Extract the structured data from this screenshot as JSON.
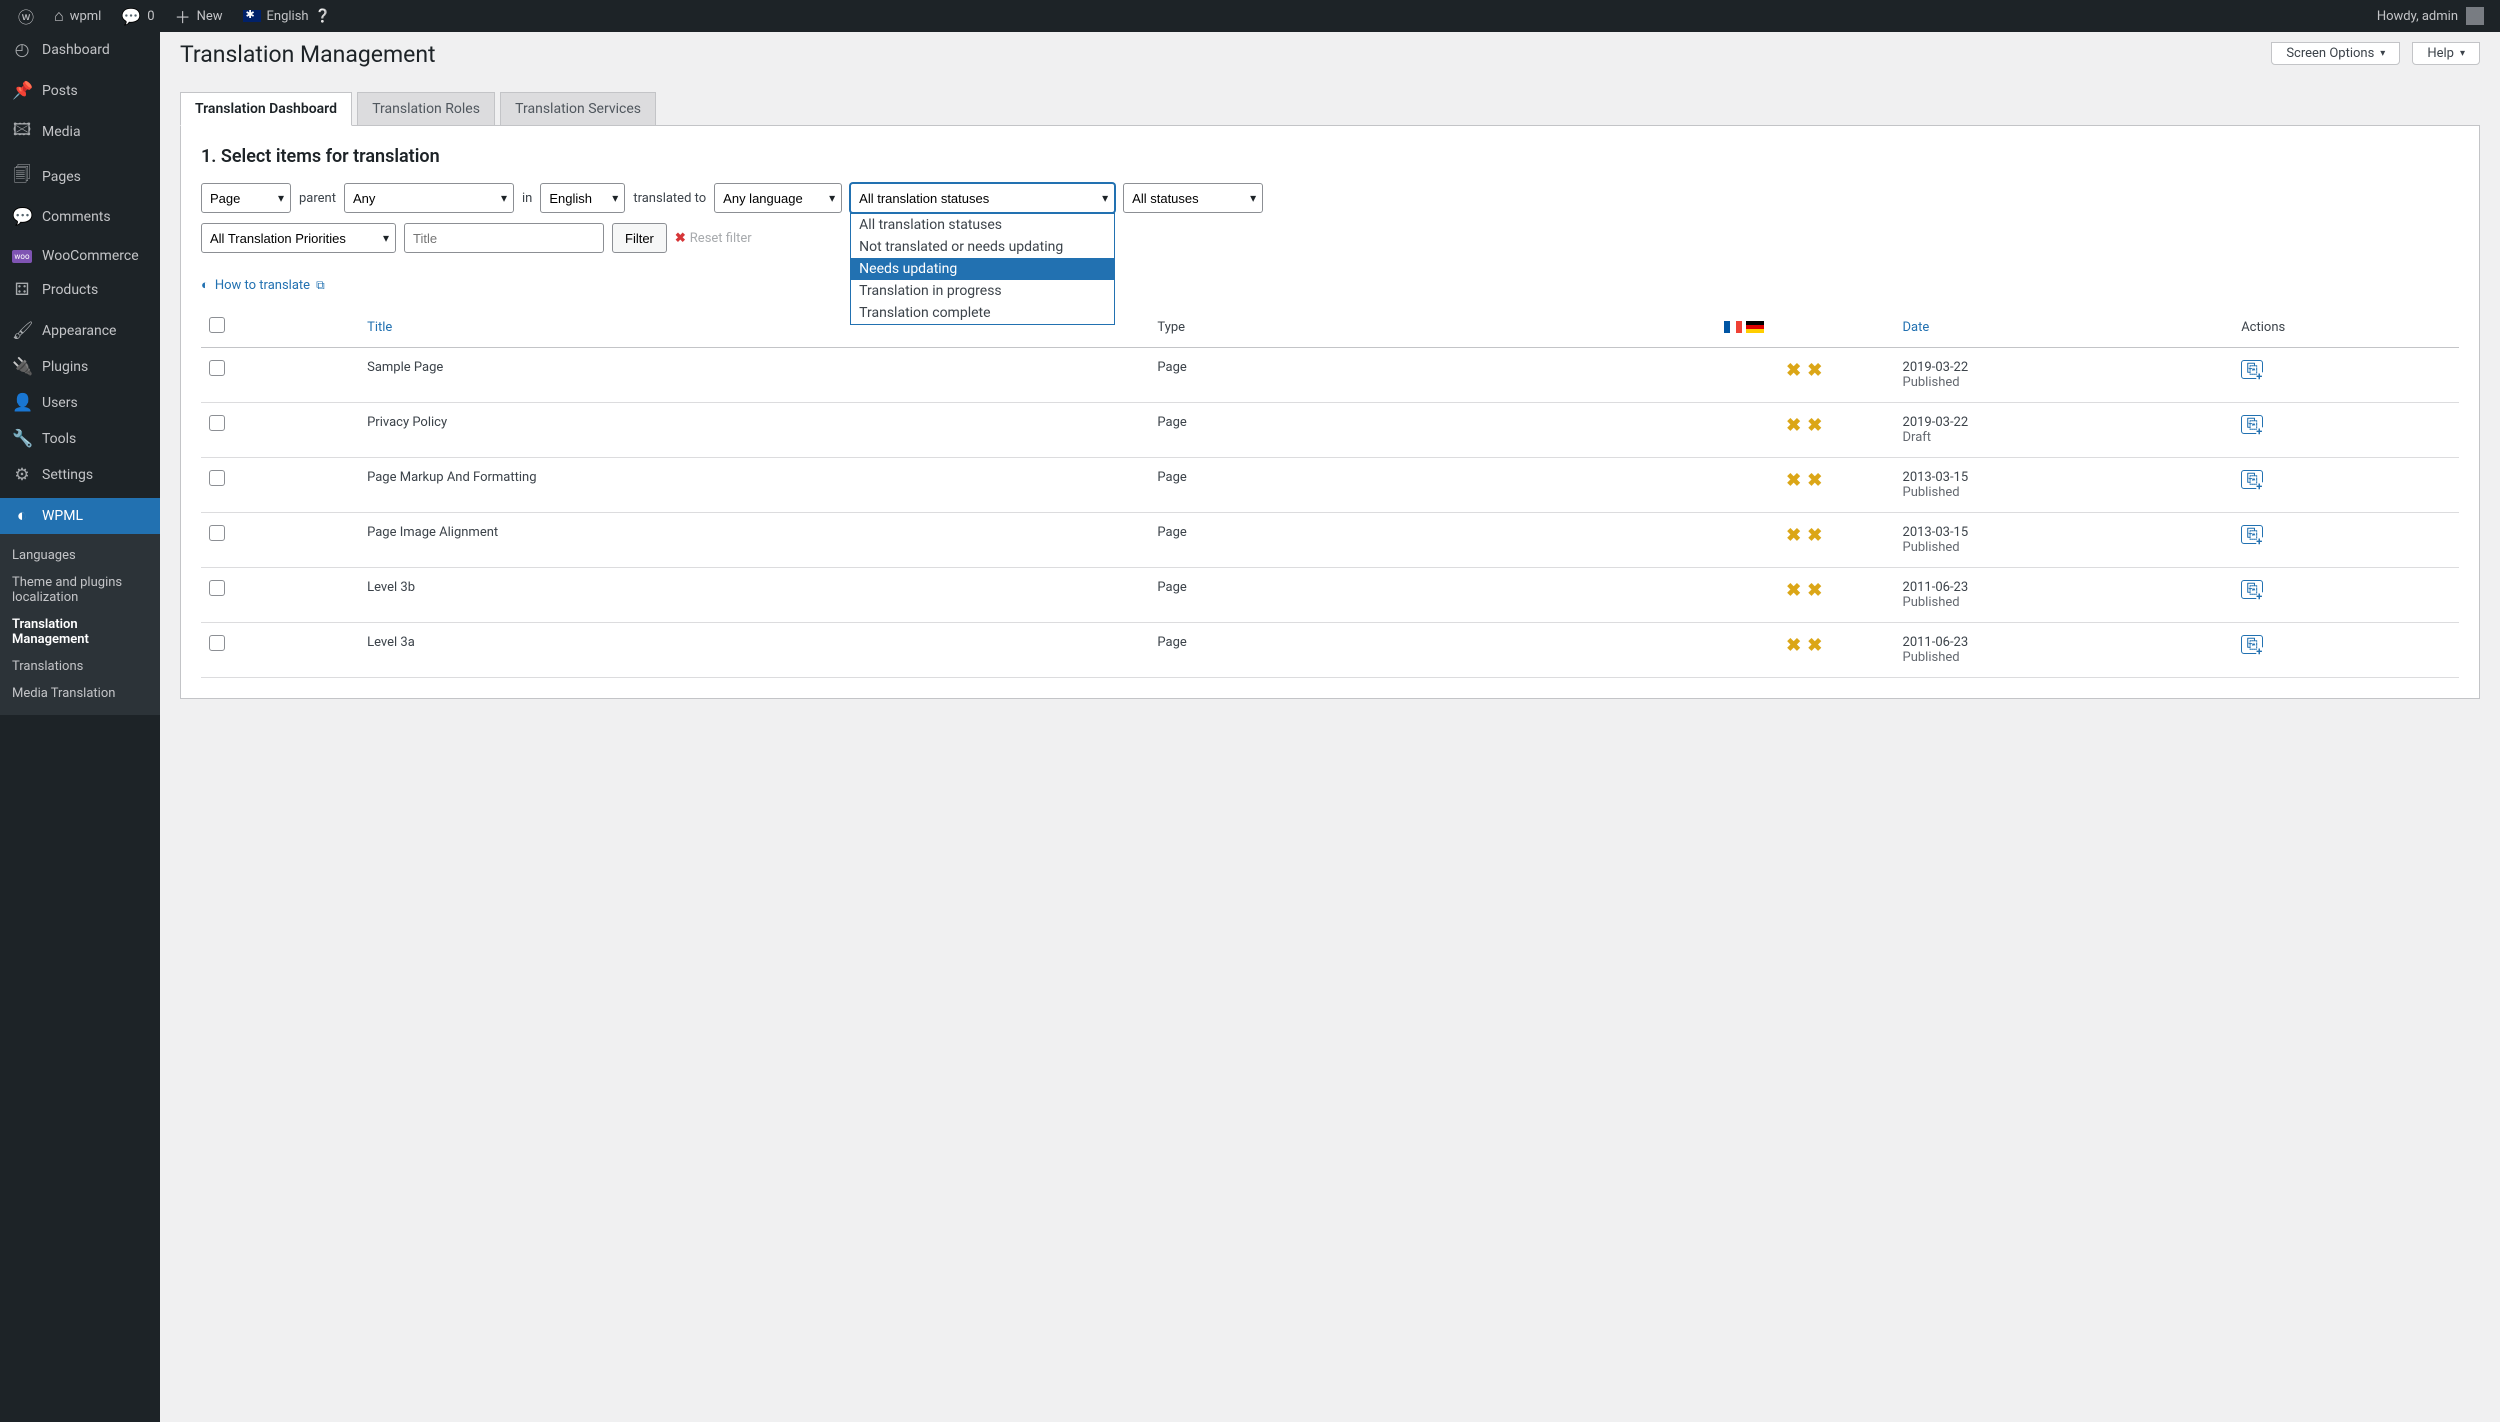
{
  "adminbar": {
    "site_name": "wpml",
    "comments_count": "0",
    "new_label": "New",
    "language": "English",
    "howdy": "Howdy, admin"
  },
  "sidebar": {
    "items": [
      {
        "icon": "⌂",
        "label": "Dashboard"
      },
      {
        "icon": "✎",
        "label": "Posts"
      },
      {
        "icon": "🖾",
        "label": "Media"
      },
      {
        "icon": "🗐",
        "label": "Pages"
      },
      {
        "icon": "💬",
        "label": "Comments"
      }
    ],
    "items2": [
      {
        "icon": "ⓦ",
        "label": "WooCommerce"
      },
      {
        "icon": "⚃",
        "label": "Products"
      }
    ],
    "items3": [
      {
        "icon": "✦",
        "label": "Appearance"
      },
      {
        "icon": "🔌",
        "label": "Plugins"
      },
      {
        "icon": "👤",
        "label": "Users"
      },
      {
        "icon": "🔧",
        "label": "Tools"
      },
      {
        "icon": "⚙",
        "label": "Settings"
      }
    ],
    "active": {
      "icon": "◐",
      "label": "WPML"
    },
    "submenu": [
      "Languages",
      "Theme and plugins localization",
      "Translation Management",
      "Translations",
      "Media Translation"
    ]
  },
  "top_buttons": {
    "screen_options": "Screen Options",
    "help": "Help"
  },
  "page_title": "Translation Management",
  "tabs": [
    "Translation Dashboard",
    "Translation Roles",
    "Translation Services"
  ],
  "section_title": "1. Select items for translation",
  "filters": {
    "type_select": "Page",
    "parent_label": "parent",
    "parent_select": "Any",
    "in_label": "in",
    "lang_select": "English",
    "translated_to_label": "translated to",
    "to_lang_select": "Any language",
    "status_select": "All translation statuses",
    "status_options": [
      "All translation statuses",
      "Not translated or needs updating",
      "Needs updating",
      "Translation in progress",
      "Translation complete"
    ],
    "pub_status_select": "All statuses",
    "priority_select": "All Translation Priorities",
    "title_placeholder": "Title",
    "filter_btn": "Filter",
    "reset_label": "Reset filter"
  },
  "how_to_translate": "How to translate",
  "table": {
    "headers": {
      "title": "Title",
      "type": "Type",
      "date": "Date",
      "actions": "Actions"
    },
    "rows": [
      {
        "title": "Sample Page",
        "type": "Page",
        "date": "2019-03-22",
        "status": "Published"
      },
      {
        "title": "Privacy Policy",
        "type": "Page",
        "date": "2019-03-22",
        "status": "Draft"
      },
      {
        "title": "Page Markup And Formatting",
        "type": "Page",
        "date": "2013-03-15",
        "status": "Published"
      },
      {
        "title": "Page Image Alignment",
        "type": "Page",
        "date": "2013-03-15",
        "status": "Published"
      },
      {
        "title": "Level 3b",
        "type": "Page",
        "date": "2011-06-23",
        "status": "Published"
      },
      {
        "title": "Level 3a",
        "type": "Page",
        "date": "2011-06-23",
        "status": "Published"
      }
    ]
  }
}
